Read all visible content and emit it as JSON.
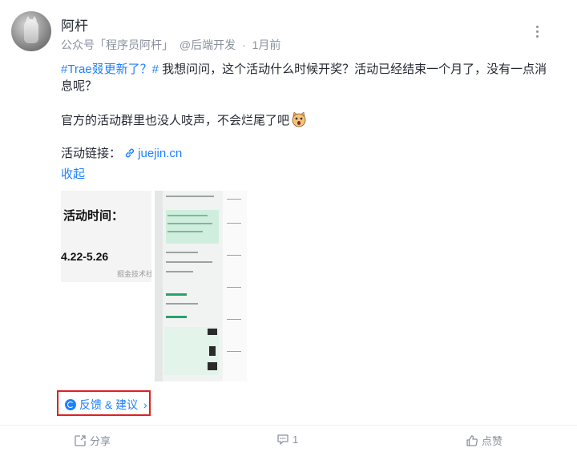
{
  "author": {
    "name": "阿杆"
  },
  "meta": {
    "company": "公众号「程序员阿杆」",
    "circle": "@后端开发",
    "separator": "·",
    "time": "1月前"
  },
  "post": {
    "hashtag": "#Trae叕更新了？#",
    "line1_rest": " 我想问问，这个活动什么时候开奖？活动已经结束一个月了，没有一点消息呢？",
    "line2": "官方的活动群里也没人吱声，不会烂尾了吧",
    "link_label": "活动链接：",
    "link_text": "juejin.cn",
    "collapse": "收起"
  },
  "images": {
    "img1_title": "活动时间：",
    "img1_dates": "4.22-5.26",
    "img1_watermark": "掘金技术社"
  },
  "feedback": {
    "label": "反馈 & 建议",
    "arrow": "›"
  },
  "actions": {
    "share": "分享",
    "comment_count": "1",
    "like": "点赞"
  },
  "colors": {
    "accent": "#1e80ff",
    "text": "#252933",
    "muted": "#8a919f",
    "highlight_border": "#e02020"
  }
}
